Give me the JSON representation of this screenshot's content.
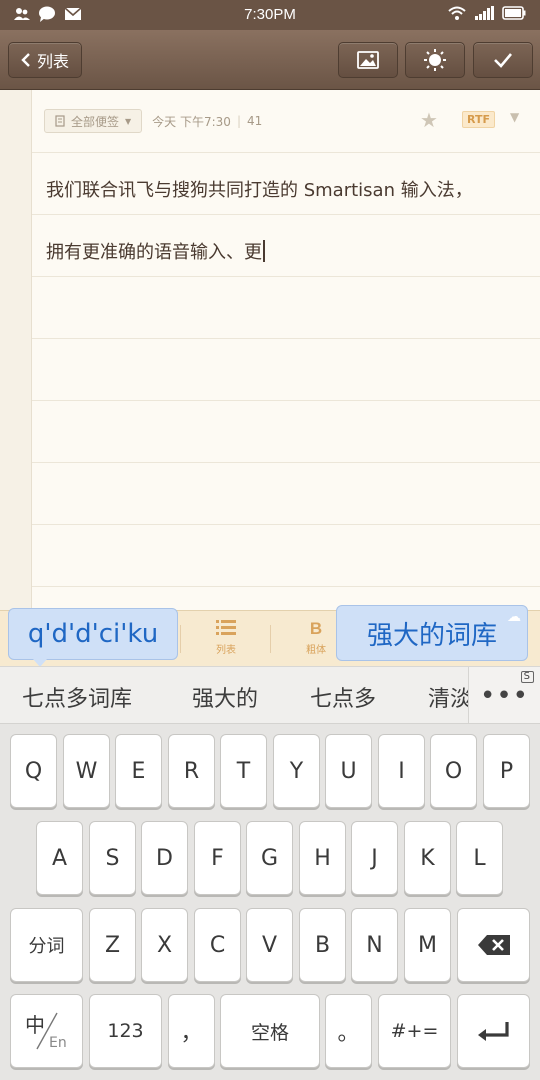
{
  "status_bar": {
    "time": "7:30PM",
    "left_icons": [
      "contacts-icon",
      "chat-bubble-icon",
      "mail-icon"
    ],
    "right_icons": [
      "wifi-icon",
      "signal-icon",
      "battery-icon"
    ]
  },
  "toolbar": {
    "back_label": "列表",
    "image_icon": "image-icon",
    "theme_icon": "sun-icon",
    "done_icon": "check-icon"
  },
  "note": {
    "tag_label": "全部便签",
    "date": "今天 下午7:30",
    "char_count": "41",
    "format_badge": "RTF",
    "lines": [
      "我们联合讯飞与搜狗共同打造的 Smartisan 输入法，",
      "拥有更准确的语音输入、更"
    ]
  },
  "format_bar": {
    "list_label": "列表",
    "bold_glyph": "B",
    "bold_label": "粗体"
  },
  "ime": {
    "pinyin_composition": "q'd'd'ci'ku",
    "highlighted_candidate": "强大的词库",
    "candidates": [
      "七点多词库",
      "强大的",
      "七点多",
      "清淡"
    ],
    "more_label": "•••",
    "more_badge": "S"
  },
  "keyboard": {
    "row1": [
      "Q",
      "W",
      "E",
      "R",
      "T",
      "Y",
      "U",
      "I",
      "O",
      "P"
    ],
    "row2": [
      "A",
      "S",
      "D",
      "F",
      "G",
      "H",
      "J",
      "K",
      "L"
    ],
    "row3_left": "分词",
    "row3": [
      "Z",
      "X",
      "C",
      "V",
      "B",
      "N",
      "M"
    ],
    "row4": {
      "lang_main": "中",
      "lang_sub": "En",
      "num": "123",
      "comma": "，",
      "space": "空格",
      "period": "。",
      "symbols": "#+="
    }
  }
}
